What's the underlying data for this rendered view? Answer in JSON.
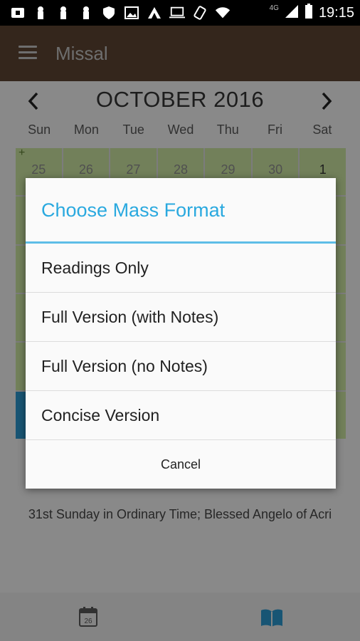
{
  "status_bar": {
    "time": "19:15",
    "network": "4G",
    "icons": [
      "notification-icon",
      "bookmark-icon",
      "bookmark-icon",
      "bookmark-icon",
      "shield-icon",
      "image-icon",
      "a-icon",
      "laptop-icon",
      "rotate-icon",
      "wifi-icon",
      "signal-icon",
      "battery-icon"
    ]
  },
  "app_bar": {
    "title": "Missal",
    "menu_icon": "hamburger-menu-icon"
  },
  "calendar": {
    "month": "OCTOBER 2016",
    "prev_icon": "chevron-left-icon",
    "next_icon": "chevron-right-icon",
    "weekdays": [
      "Sun",
      "Mon",
      "Tue",
      "Wed",
      "Thu",
      "Fri",
      "Sat"
    ],
    "first_row": [
      "25",
      "26",
      "27",
      "28",
      "29",
      "30",
      "1"
    ],
    "highlight_color": "#2a93c9",
    "cell_color": "#c4dd9c"
  },
  "feast_text": "31st Sunday in Ordinary Time; Blessed Angelo of Acri",
  "dialog": {
    "title": "Choose Mass Format",
    "options": [
      "Readings Only",
      "Full Version (with Notes)",
      "Full Version (no Notes)",
      "Concise Version"
    ],
    "cancel": "Cancel"
  },
  "bottom_nav": {
    "calendar_icon": "calendar-icon",
    "calendar_day": "26",
    "book_icon": "book-icon",
    "active_color": "#2a93c9"
  }
}
